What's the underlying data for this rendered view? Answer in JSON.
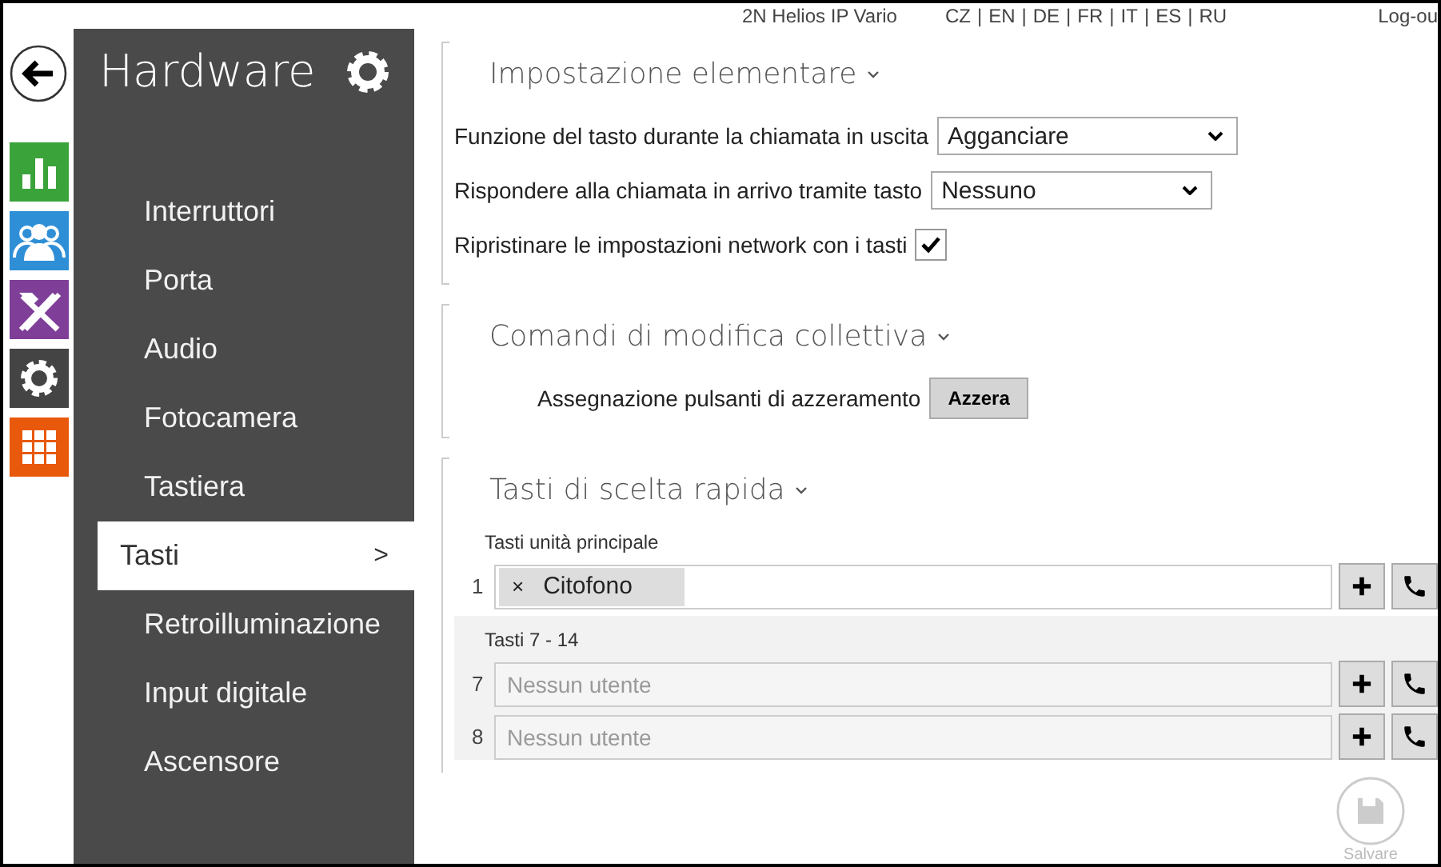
{
  "top_bar": {
    "device": "2N Helios IP Vario",
    "separator": "|",
    "languages": [
      {
        "label": "CZ"
      },
      {
        "label": "EN"
      },
      {
        "label": "DE"
      },
      {
        "label": "FR"
      },
      {
        "label": "IT"
      },
      {
        "label": "ES"
      },
      {
        "label": "RU"
      }
    ],
    "logout": "Log-ou"
  },
  "rail": [
    {
      "kind": "chart"
    },
    {
      "kind": "users"
    },
    {
      "kind": "tools"
    },
    {
      "kind": "gear"
    },
    {
      "kind": "grid"
    }
  ],
  "sidebar": {
    "title": "Hardware",
    "items": [
      {
        "label": "Interruttori",
        "selected": false
      },
      {
        "label": "Porta",
        "selected": false
      },
      {
        "label": "Audio",
        "selected": false
      },
      {
        "label": "Fotocamera",
        "selected": false
      },
      {
        "label": "Tastiera",
        "selected": false
      },
      {
        "label": "Tasti",
        "selected": true,
        "chevron": ">"
      },
      {
        "label": "Retroilluminazione",
        "selected": false
      },
      {
        "label": "Input digitale",
        "selected": false
      },
      {
        "label": "Ascensore",
        "selected": false
      }
    ]
  },
  "sections": [
    {
      "title": "Impostazione elementare",
      "fields": [
        {
          "kind": "select",
          "label": "Funzione del tasto durante la chiamata in uscita",
          "value": "Agganciare"
        },
        {
          "kind": "select",
          "label": "Rispondere alla chiamata in arrivo tramite tasto",
          "value": "Nessuno"
        },
        {
          "kind": "checkbox",
          "label": "Ripristinare le impostazioni network con i tasti",
          "checked": true
        }
      ]
    },
    {
      "title": "Comandi di modifica collettiva",
      "fields": [
        {
          "kind": "button",
          "label": "Assegnazione pulsanti di azzeramento",
          "button": "Azzera"
        }
      ]
    },
    {
      "title": "Tasti di scelta rapida",
      "groups": [
        {
          "title": "Tasti unità principale",
          "shaded": false,
          "rows": [
            {
              "number": "1",
              "tag": "Citofono",
              "remove": "×"
            }
          ]
        },
        {
          "title": "Tasti 7 - 14",
          "shaded": true,
          "rows": [
            {
              "number": "7",
              "placeholder": "Nessun utente"
            },
            {
              "number": "8",
              "placeholder": "Nessun utente"
            }
          ]
        }
      ]
    }
  ],
  "save": {
    "label": "Salvare",
    "disabled": true
  }
}
